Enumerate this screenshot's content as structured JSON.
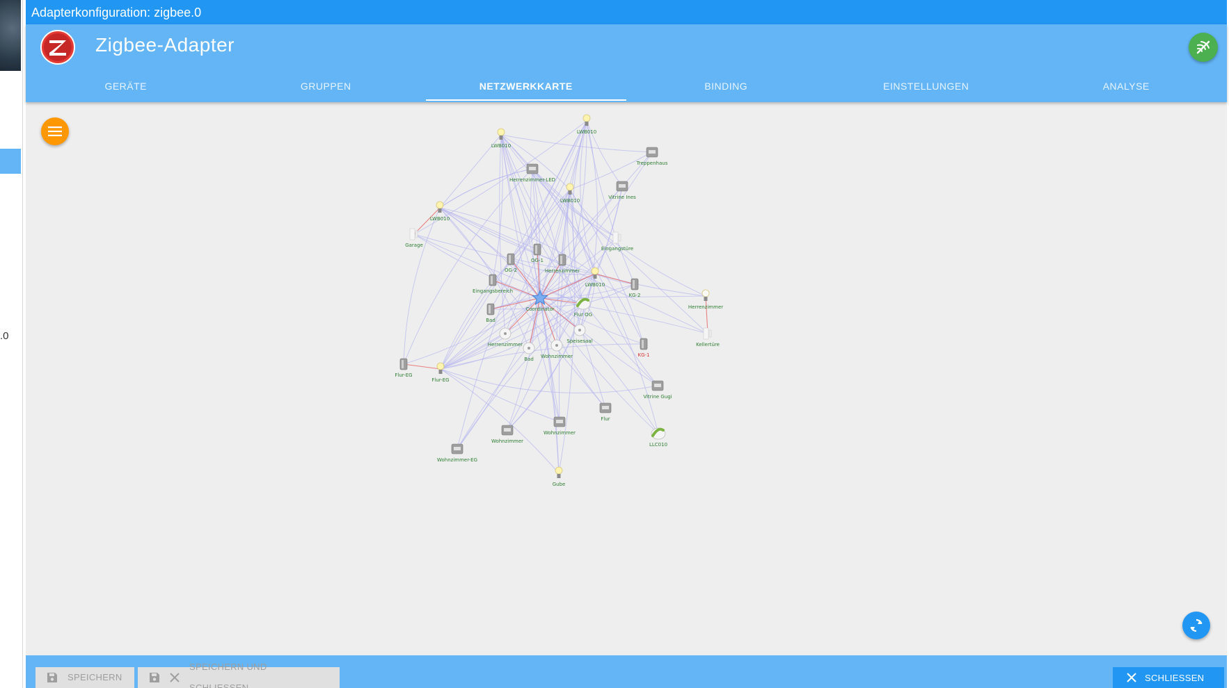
{
  "background": {
    "fragment_text": ".0"
  },
  "window": {
    "title": "Adapterkonfiguration: zigbee.0"
  },
  "app": {
    "title": "Zigbee-Adapter"
  },
  "tabs": [
    {
      "label": "GERÄTE"
    },
    {
      "label": "GRUPPEN"
    },
    {
      "label": "NETZWERKKARTE",
      "active": true
    },
    {
      "label": "BINDING"
    },
    {
      "label": "EINSTELLUNGEN"
    },
    {
      "label": "ANALYSE"
    }
  ],
  "footer": {
    "save_label": "SPEICHERN",
    "save_close_label": "SPEICHERN UND SCHLIESSEN",
    "close_label": "SCHLIESSEN"
  },
  "colors": {
    "primary": "#2196f3",
    "appbar": "#64b5f6",
    "menu_fab": "#ff9800",
    "network_fab": "#4caf50",
    "link": "#b3b3f0",
    "direct_link": "#e57373",
    "label_ok": "#2e7d32",
    "label_offline": "#d32f2f"
  },
  "network": {
    "nodes": [
      {
        "id": "coord",
        "label": "Coordinator",
        "type": "coordinator",
        "label_color": "green"
      },
      {
        "id": "n1",
        "label": "LWB010",
        "type": "bulb",
        "label_color": "green"
      },
      {
        "id": "n2",
        "label": "LWB010",
        "type": "bulb",
        "label_color": "green"
      },
      {
        "id": "n3",
        "label": "Treppenhaus",
        "type": "plug",
        "label_color": "green"
      },
      {
        "id": "n4",
        "label": "Herrenzimmer-LED",
        "type": "plug",
        "label_color": "green"
      },
      {
        "id": "n5",
        "label": "Vitrine Ines",
        "type": "plug",
        "label_color": "green"
      },
      {
        "id": "n6",
        "label": "LWB010",
        "type": "bulb",
        "label_color": "green"
      },
      {
        "id": "n7",
        "label": "LWB010",
        "type": "bulb",
        "label_color": "green"
      },
      {
        "id": "n8",
        "label": "Garage",
        "type": "door",
        "label_color": "green"
      },
      {
        "id": "n9",
        "label": "Eingangstüre",
        "type": "door",
        "label_color": "green"
      },
      {
        "id": "n10",
        "label": "OG-1",
        "type": "thermostat",
        "label_color": "green"
      },
      {
        "id": "n11",
        "label": "OG-2",
        "type": "thermostat",
        "label_color": "green"
      },
      {
        "id": "n12",
        "label": "Herrenzimmer",
        "type": "thermostat",
        "label_color": "green"
      },
      {
        "id": "n13",
        "label": "LWB010",
        "type": "bulb",
        "label_color": "green"
      },
      {
        "id": "n14",
        "label": "KG-2",
        "type": "thermostat",
        "label_color": "green"
      },
      {
        "id": "n15",
        "label": "Eingangsbereich",
        "type": "thermostat",
        "label_color": "green"
      },
      {
        "id": "n16",
        "label": "Herrenzimmer",
        "type": "bulb-white",
        "label_color": "green"
      },
      {
        "id": "n17",
        "label": "Bad",
        "type": "thermostat",
        "label_color": "green"
      },
      {
        "id": "n18",
        "label": "Flur OG",
        "type": "strip",
        "label_color": "green"
      },
      {
        "id": "n19",
        "label": "Kellertüre",
        "type": "door",
        "label_color": "green"
      },
      {
        "id": "n20",
        "label": "Speisesaal",
        "type": "sensor",
        "label_color": "green"
      },
      {
        "id": "n21",
        "label": "Herrenzimmer",
        "type": "sensor",
        "label_color": "green"
      },
      {
        "id": "n22",
        "label": "Bad",
        "type": "sensor",
        "label_color": "green"
      },
      {
        "id": "n23",
        "label": "Wohnzimmer",
        "type": "sensor",
        "label_color": "green"
      },
      {
        "id": "n24",
        "label": "KG-1",
        "type": "thermostat",
        "label_color": "red"
      },
      {
        "id": "n25",
        "label": "Flur-EG",
        "type": "thermostat",
        "label_color": "green"
      },
      {
        "id": "n26",
        "label": "Flur-EG",
        "type": "bulb",
        "label_color": "green"
      },
      {
        "id": "n27",
        "label": "Vitrine Gugi",
        "type": "plug",
        "label_color": "green"
      },
      {
        "id": "n28",
        "label": "Flur",
        "type": "plug",
        "label_color": "green"
      },
      {
        "id": "n29",
        "label": "Wohnzimmer",
        "type": "plug",
        "label_color": "green"
      },
      {
        "id": "n30",
        "label": "Wohnzimmer",
        "type": "plug",
        "label_color": "green"
      },
      {
        "id": "n31",
        "label": "LLC010",
        "type": "strip",
        "label_color": "green"
      },
      {
        "id": "n32",
        "label": "Wohnzimmer-EG",
        "type": "plug",
        "label_color": "green"
      },
      {
        "id": "n33",
        "label": "Gube",
        "type": "bulb",
        "label_color": "green"
      }
    ]
  }
}
